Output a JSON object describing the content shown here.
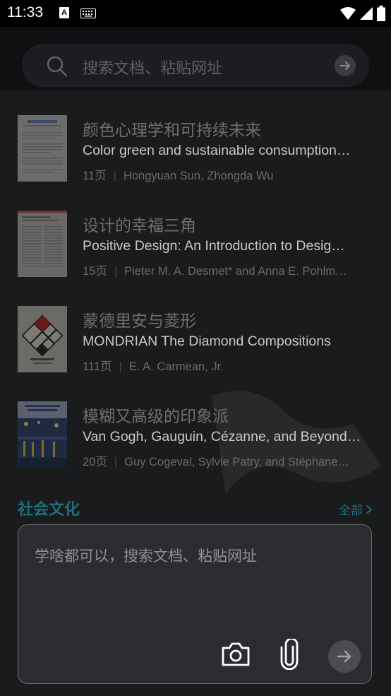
{
  "status_bar": {
    "time": "11:33",
    "icons": [
      "a-notification-icon",
      "keyboard-icon",
      "wifi-icon",
      "signal-icon",
      "battery-icon"
    ]
  },
  "search": {
    "placeholder": "搜索文档、粘贴网址",
    "icon": "search-icon"
  },
  "documents": [
    {
      "title": "颜色心理学和可持续未来",
      "subtitle": "Color green and sustainable consumption…",
      "pages": "11页",
      "authors": "Hongyuan Sun, Zhongda Wu"
    },
    {
      "title": "设计的幸福三角",
      "subtitle": "Positive Design: An Introduction to Desig…",
      "pages": "15页",
      "authors": "Pieter M. A. Desmet* and Anna E. Pohlm…"
    },
    {
      "title": "蒙德里安与菱形",
      "subtitle": "MONDRIAN The Diamond Compositions",
      "pages": "111页",
      "authors": "E. A. Carmean, Jr."
    },
    {
      "title": "模糊又高级的印象派",
      "subtitle": "Van Gogh, Gauguin, Cézanne, and Beyond…",
      "pages": "20页",
      "authors": "Guy Cogeval, Sylvie Patry, and Stéphane…"
    }
  ],
  "section": {
    "title": "社会文化",
    "all_label": "全部"
  },
  "composer": {
    "placeholder": "学啥都可以，搜索文档、粘贴网址"
  },
  "colors": {
    "accent": "#1f6e7e",
    "background": "#1a1b1d"
  }
}
